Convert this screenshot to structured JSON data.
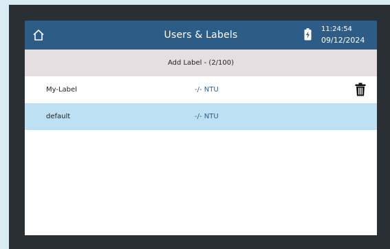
{
  "header": {
    "title": "Users & Labels",
    "time": "11:24:54",
    "date": "09/12/2024"
  },
  "add_label": {
    "text": "Add Label - (2/100)"
  },
  "labels": [
    {
      "name": "My-Label",
      "value": "-/- NTU",
      "selected": false
    },
    {
      "name": "default",
      "value": "-/- NTU",
      "selected": true
    }
  ],
  "colors": {
    "header_bg": "#2d5d87",
    "add_bar_bg": "#e6dfe2",
    "selected_row_bg": "#bde1f2",
    "bezel": "#2a2f33",
    "outer_bg": "#d9ecf4"
  },
  "icons": {
    "home": "home-icon",
    "battery": "battery-charging-icon",
    "delete": "trash-icon"
  }
}
